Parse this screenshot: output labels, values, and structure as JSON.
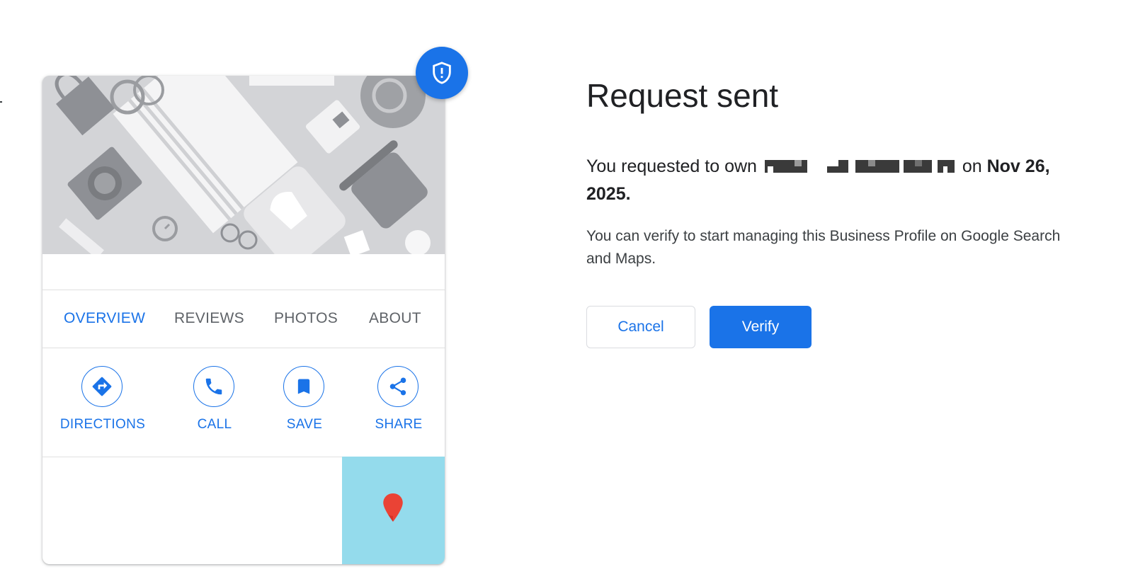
{
  "card": {
    "tabs": [
      {
        "label": "OVERVIEW",
        "active": true
      },
      {
        "label": "REVIEWS",
        "active": false
      },
      {
        "label": "PHOTOS",
        "active": false
      },
      {
        "label": "ABOUT",
        "active": false
      }
    ],
    "actions": [
      {
        "label": "DIRECTIONS",
        "icon": "directions-icon"
      },
      {
        "label": "CALL",
        "icon": "phone-icon"
      },
      {
        "label": "SAVE",
        "icon": "bookmark-icon"
      },
      {
        "label": "SHARE",
        "icon": "share-icon"
      }
    ],
    "badge_icon": "shield-alert-icon",
    "map_pin_icon": "map-pin-icon"
  },
  "panel": {
    "title": "Request sent",
    "request_prefix": "You requested to own",
    "request_on": "on",
    "request_date": "Nov 26, 2025.",
    "description": "You can verify to start managing this Business Profile on Google Search and Maps.",
    "cancel_label": "Cancel",
    "verify_label": "Verify"
  },
  "colors": {
    "accent": "#1a73e8",
    "map_water": "#94dbec",
    "pin": "#ea4335",
    "hero_bg": "#d3d4d7"
  }
}
